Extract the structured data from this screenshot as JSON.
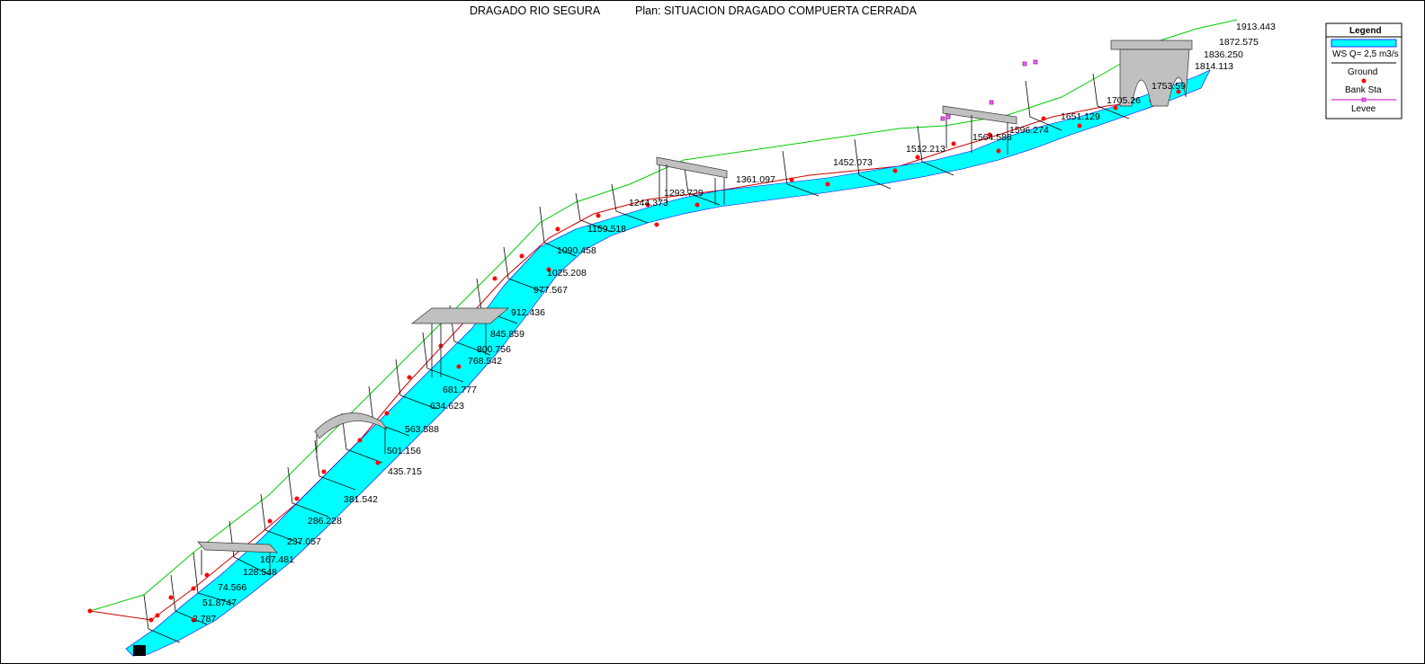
{
  "header": {
    "project": "DRAGADO RIO SEGURA",
    "plan": "Plan: SITUACION DRAGADO COMPUERTA CERRADA"
  },
  "legend": {
    "title": "Legend",
    "ws": "WS Q= 2,5 m3/s",
    "ground": "Ground",
    "bank": "Bank Sta",
    "levee": "Levee"
  },
  "stations": [
    "2.787",
    "51.8747",
    "74.566",
    "128.548",
    "167.481",
    "237.057",
    "286.228",
    "381.542",
    "435.715",
    "501.156",
    "563.588",
    "634.623",
    "681.777",
    "768.542",
    "800.756",
    "845.859",
    "912.436",
    "977.567",
    "1025.208",
    "1090.458",
    "1159.518",
    "1244.373",
    "1293.729",
    "1361.097",
    "1452.073",
    "1512.213",
    "1564.586",
    "1596.274",
    "1651.129",
    "1705.26",
    "1753.59",
    "1814.113",
    "1836.250",
    "1872.575",
    "1913.443"
  ],
  "colors": {
    "water": "#00ffff",
    "ground": "#000000",
    "bank": "#ff0000",
    "levee": "#cc00cc",
    "terrain": "#00cc00",
    "bridge": "#c0c0c0"
  }
}
